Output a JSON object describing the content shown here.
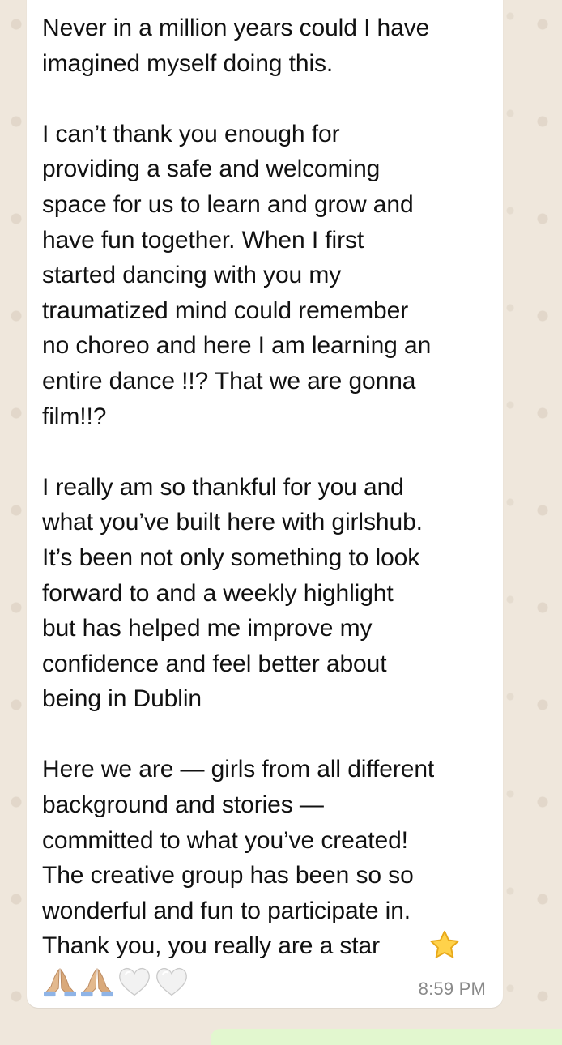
{
  "message": {
    "text": "Never in a million years could I have\nimagined myself doing this.\n\nI can’t thank you enough for\nproviding a safe and welcoming\nspace for us to learn and grow and\nhave fun together. When I first\nstarted dancing with you my\ntraumatized mind could remember\nno choreo and here I am learning an\nentire dance !!? That we are gonna\nfilm!!?\n\nI really am so thankful for you and\nwhat you’ve built here with girlshub.\nIt’s been not only something to look\nforward to and a weekly highlight\nbut has helped me improve my\nconfidence and feel better about\nbeing in Dublin\n\nHere we are — girls from all different\nbackground and stories —\ncommitted to what you’ve created!\nThe creative group has been so so\nwonderful and fun to participate in.\nThank you, you really are a star",
    "time": "8:59 PM",
    "emojis": [
      "star-emoji",
      "praying-hands-emoji",
      "praying-hands-emoji",
      "white-heart-emoji",
      "white-heart-emoji"
    ]
  },
  "colors": {
    "wallpaper": "#efe7dc",
    "bubble": "#ffffff",
    "text": "#111111",
    "timestamp": "#8a8a8a",
    "outgoing_bubble": "#e2f7cf"
  }
}
